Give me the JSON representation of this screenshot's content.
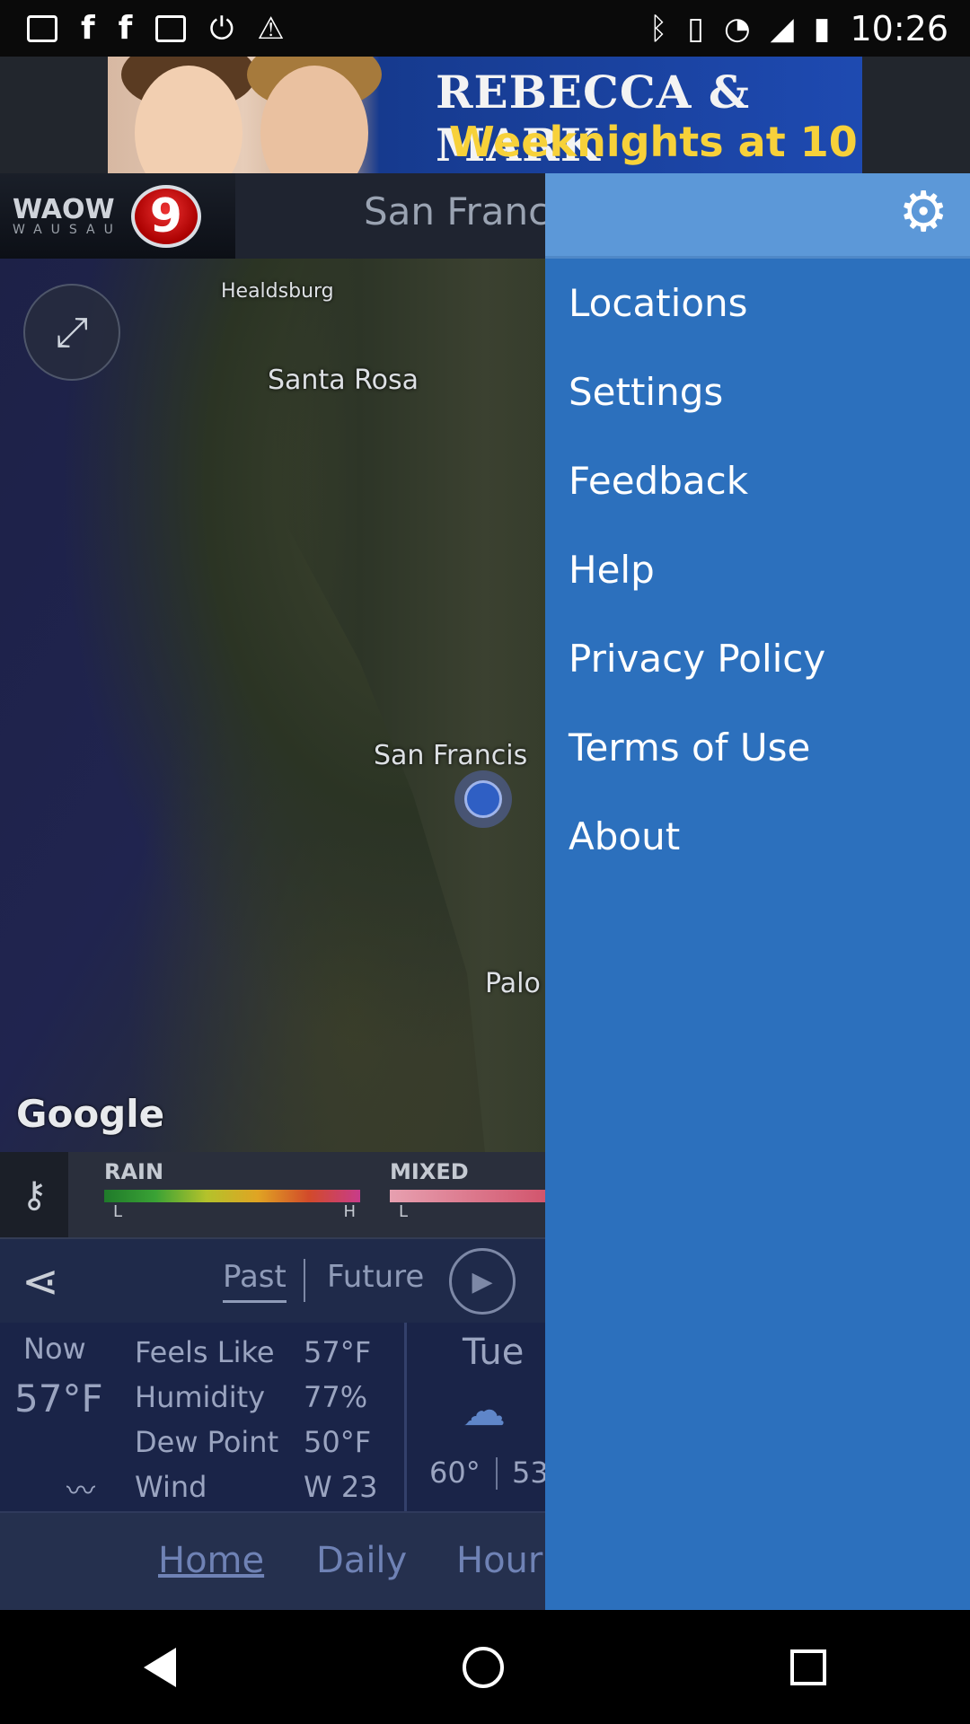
{
  "status_bar": {
    "time": "10:26",
    "left_icons": [
      "message-icon",
      "facebook-icon",
      "facebook-icon",
      "image-icon",
      "notification-icon",
      "alert-icon"
    ],
    "right_icons": [
      "bluetooth-icon",
      "vibrate-icon",
      "wifi-icon",
      "signal-icon",
      "battery-icon"
    ]
  },
  "ad": {
    "line1": "REBECCA & MARK",
    "line2": "Weeknights at 10"
  },
  "header": {
    "logo_text": "WAOW",
    "logo_subtext": "WAUSAU",
    "logo_number": "9",
    "title": "San Franci"
  },
  "map": {
    "labels": {
      "healdsburg": "Healdsburg",
      "santa_rosa": "Santa Rosa",
      "san_francisco": "San Francis",
      "palo": "Palo"
    },
    "attribution": "Google"
  },
  "legend": {
    "rain": {
      "title": "RAIN",
      "low": "L",
      "high": "H"
    },
    "mixed": {
      "title": "MIXED",
      "low": "L"
    }
  },
  "controls": {
    "past": "Past",
    "future": "Future"
  },
  "current": {
    "now_label": "Now",
    "temp": "57°F",
    "rows": [
      {
        "label": "Feels Like",
        "value": "57°F"
      },
      {
        "label": "Humidity",
        "value": "77%"
      },
      {
        "label": "Dew Point",
        "value": "50°F"
      },
      {
        "label": "Wind",
        "value": "W 23"
      }
    ]
  },
  "forecast": {
    "day": "Tue",
    "hi": "60°",
    "lo": "53"
  },
  "bottom_tabs": {
    "home": "Home",
    "daily": "Daily",
    "hourly": "Hour"
  },
  "drawer": {
    "items": [
      "Locations",
      "Settings",
      "Feedback",
      "Help",
      "Privacy Policy",
      "Terms of Use",
      "About"
    ]
  },
  "colors": {
    "drawer_bg": "#2c70bd",
    "drawer_header": "#5c98d8",
    "ad_yellow": "#f7d13a",
    "logo_red": "#cc1111"
  }
}
